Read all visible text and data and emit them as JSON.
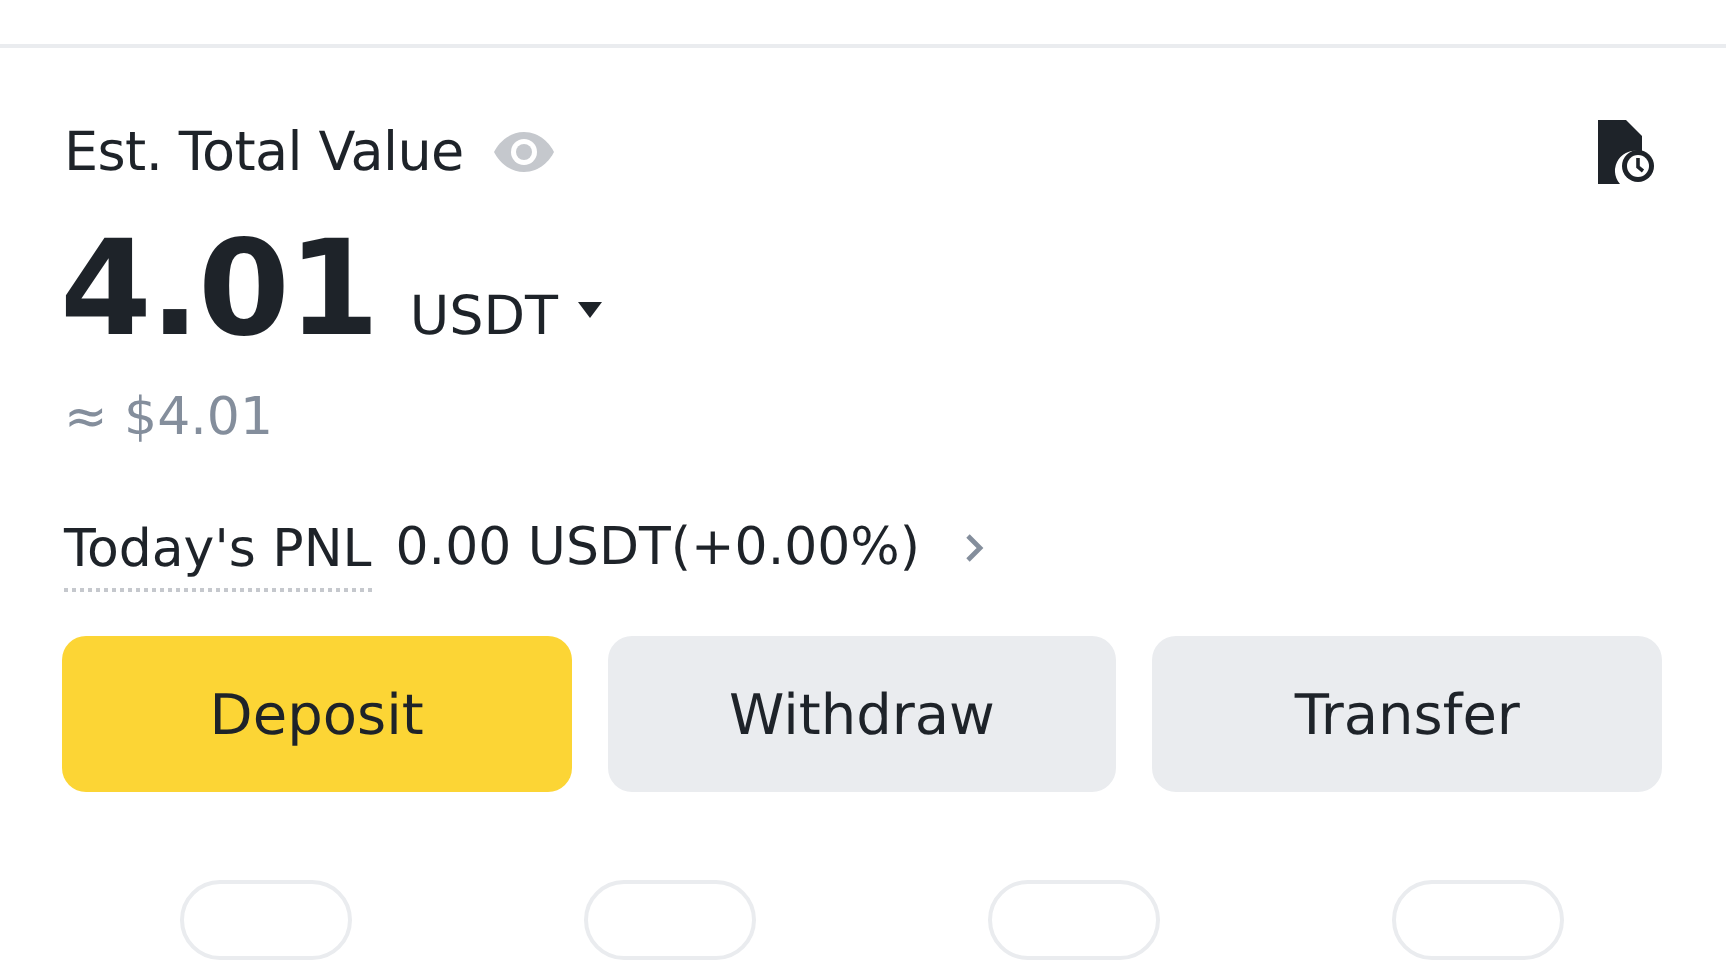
{
  "header": {
    "label": "Est. Total Value"
  },
  "balance": {
    "amount": "4.01",
    "currency": "USDT",
    "approx": "≈ $4.01"
  },
  "pnl": {
    "label": "Today's PNL",
    "value": "0.00 USDT(+0.00%)"
  },
  "buttons": [
    {
      "label": "Deposit",
      "kind": "primary"
    },
    {
      "label": "Withdraw",
      "kind": "secondary"
    },
    {
      "label": "Transfer",
      "kind": "secondary"
    }
  ]
}
